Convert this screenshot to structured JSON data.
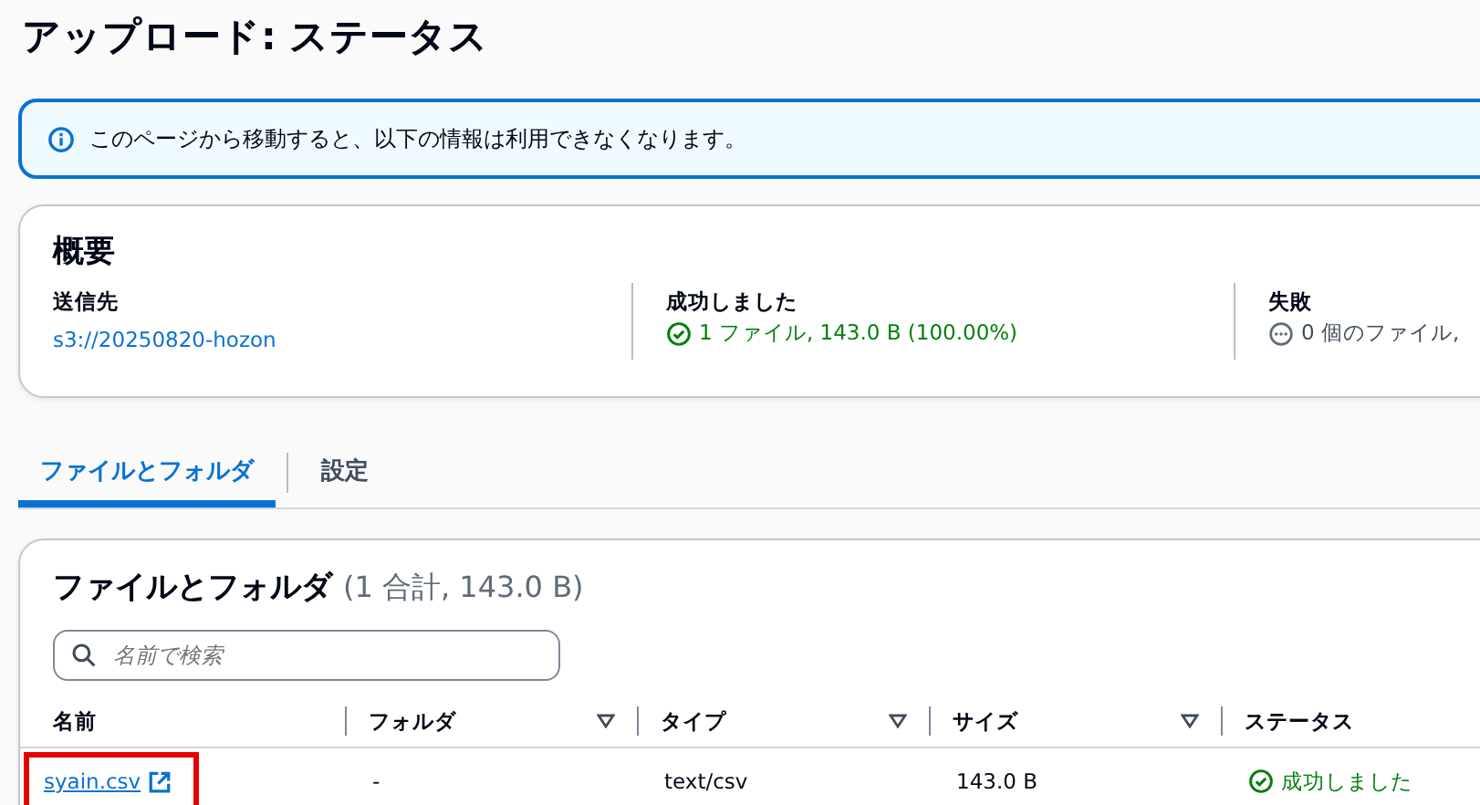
{
  "page": {
    "title": "アップロード: ステータス"
  },
  "alert": {
    "message": "このページから移動すると、以下の情報は利用できなくなります。"
  },
  "summary": {
    "title": "概要",
    "items": [
      {
        "kind": "link",
        "label": "送信先",
        "value": "s3://20250820-hozon"
      },
      {
        "kind": "success",
        "label": "成功しました",
        "value": "1 ファイル, 143.0 B (100.00%)"
      },
      {
        "kind": "pending",
        "label": "失敗",
        "value": "0 個のファイル,"
      }
    ]
  },
  "tabs": [
    {
      "label": "ファイルとフォルダ",
      "selected": true
    },
    {
      "label": "設定",
      "selected": false
    }
  ],
  "table": {
    "title": "ファイルとフォルダ",
    "count": "(1 合計, 143.0 B)",
    "search": {
      "placeholder": "名前で検索"
    },
    "columns": [
      {
        "label": "名前",
        "sortable": false
      },
      {
        "label": "フォルダ",
        "sortable": true
      },
      {
        "label": "タイプ",
        "sortable": true
      },
      {
        "label": "サイズ",
        "sortable": true
      },
      {
        "label": "ステータス",
        "sortable": false
      }
    ],
    "rows": [
      {
        "name": "syain.csv",
        "folder": "-",
        "type": "text/csv",
        "size": "143.0 B",
        "status": "成功しました",
        "highlighted": true
      }
    ]
  }
}
